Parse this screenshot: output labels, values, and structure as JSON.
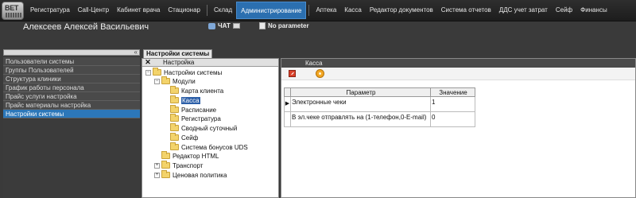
{
  "logo": {
    "text": "BET"
  },
  "nav": {
    "items": [
      "Регистратура",
      "Call-Центр",
      "Кабинет врача",
      "Стационар",
      "Склад",
      "Администрирование",
      "Аптека",
      "Касса",
      "Редактор документов",
      "Система отчетов",
      "ДДС учет затрат",
      "Сейф",
      "Финансы"
    ],
    "active": "Администрирование"
  },
  "user": {
    "name": "Алексеев Алексей Васильевич"
  },
  "chat_label": "ЧАТ",
  "no_parameter": "No parameter",
  "main_tab": "Настройки системы",
  "sidebar": {
    "items": [
      "Пользователи системы",
      "Группы Пользователей",
      "Структура клиники",
      "График работы персонала",
      "Прайс услуги настройка",
      "Прайс материалы настройка",
      "Настройки системы"
    ],
    "active_index": 6
  },
  "tree_panel": {
    "title": "Настройка",
    "nodes": {
      "root": "Настройки системы",
      "modules": "Модули",
      "karta": "Карта клиента",
      "kassa": "Касса",
      "raspisanie": "Расписание",
      "registratura": "Регистратура",
      "svodny": "Сводный суточный",
      "seif": "Сейф",
      "bonus": "Система бонусов UDS",
      "html": "Редактор HTML",
      "transport": "Транспорт",
      "cenovaya": "Ценовая политика"
    }
  },
  "right_panel": {
    "title": "Касса",
    "columns": {
      "param": "Параметр",
      "value": "Значение"
    },
    "rows": [
      {
        "param": "Электронные чеки",
        "value": "1"
      },
      {
        "param": "В эл.чеке отправлять на (1-телефон,0-E-mail)",
        "value": "0"
      }
    ]
  }
}
